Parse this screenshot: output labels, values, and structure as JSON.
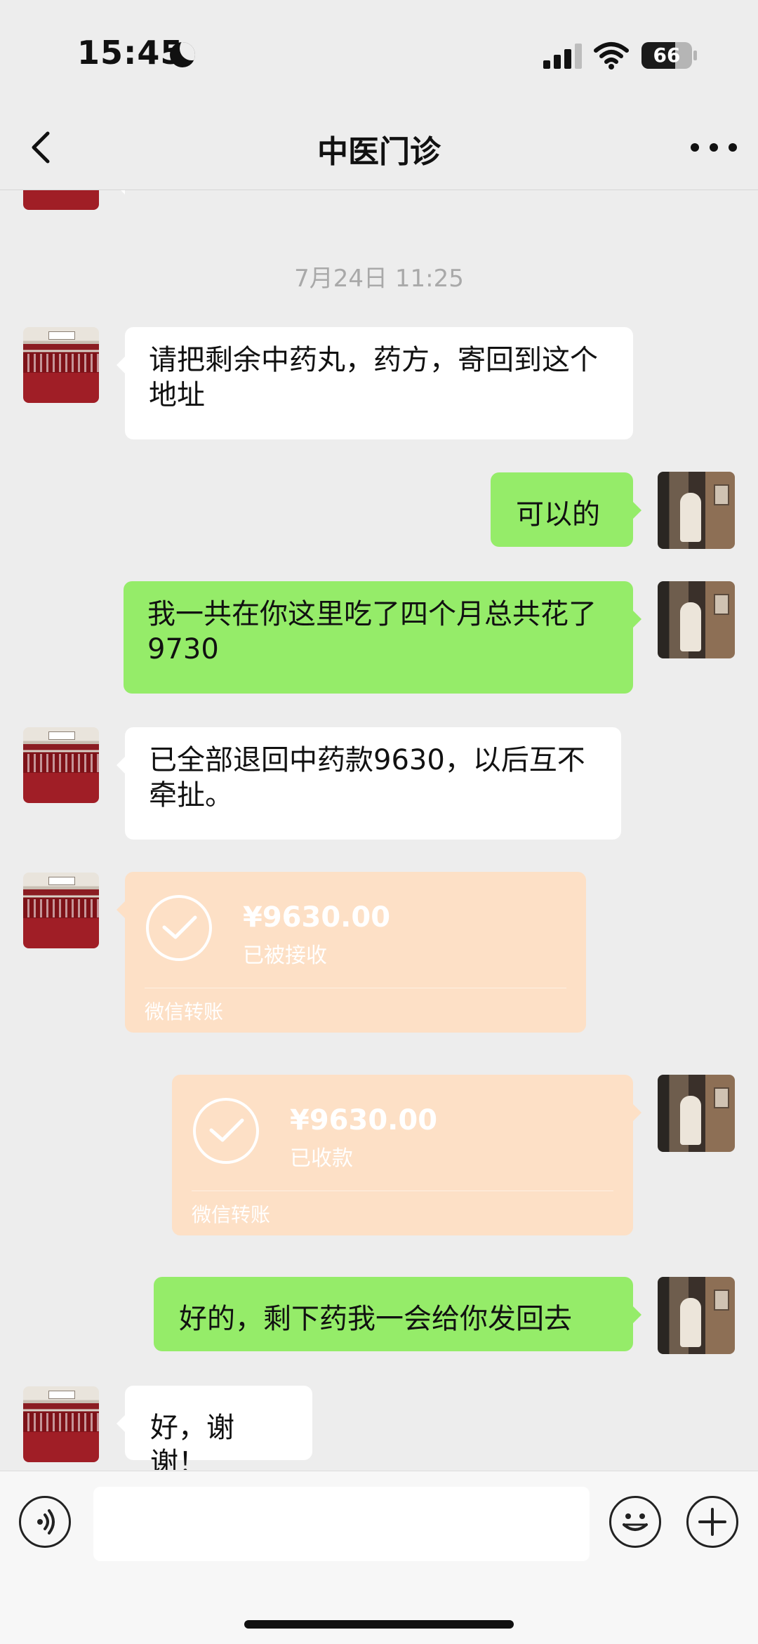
{
  "status_bar": {
    "time": "15:45",
    "battery": "66",
    "battery_fraction": 0.66
  },
  "header": {
    "title": "中医门诊"
  },
  "messages": {
    "timestamp": "7月24日 11:25",
    "m1": "请把剩余中药丸，药方，寄回到这个地址",
    "m2": "可以的",
    "m3": "我一共在你这里吃了四个月总共花了9730",
    "m4": "已全部退回中药款9630，以后互不牵扯。",
    "transfer1": {
      "amount": "¥9630.00",
      "status": "已被接收",
      "label": "微信转账"
    },
    "transfer2": {
      "amount": "¥9630.00",
      "status": "已收款",
      "label": "微信转账"
    },
    "m5": "好的，剩下药我一会给你发回去",
    "m6": "好，谢谢！"
  },
  "colors": {
    "incoming": "#ffffff",
    "outgoing": "#95ec69",
    "transfer": "#fde0c6",
    "background": "#ededed"
  },
  "icons": [
    "moon-icon",
    "signal-icon",
    "wifi-icon",
    "battery-icon",
    "back-icon",
    "more-icon",
    "voice-icon",
    "emoji-icon",
    "plus-icon",
    "check-icon"
  ]
}
